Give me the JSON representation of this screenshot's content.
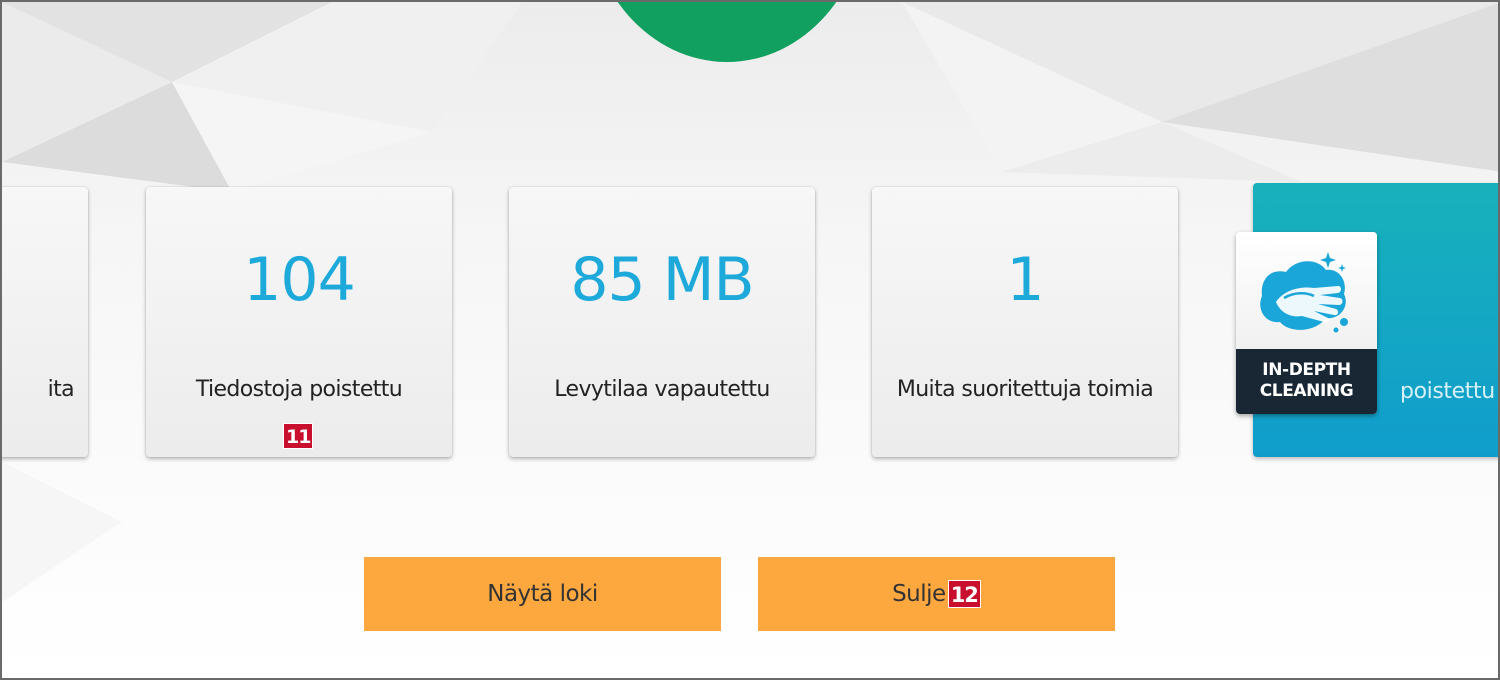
{
  "stats": {
    "partial_label": "ita",
    "files": {
      "value": "104",
      "label": "Tiedostoja poistettu"
    },
    "disk": {
      "value": "85 MB",
      "label": "Levytilaa vapautettu"
    },
    "actions": {
      "value": "1",
      "label": "Muita suoritettuja toimia"
    }
  },
  "promo": {
    "badge_line1": "IN-DEPTH",
    "badge_line2": "CLEANING",
    "side_text": "poistettu",
    "icon": "hand-washing-icon"
  },
  "markers": {
    "m11": "11",
    "m12": "12"
  },
  "buttons": {
    "log": "Näytä loki",
    "close": "Sulje"
  },
  "colors": {
    "accent_value": "#1da9da",
    "button": "#fda83e",
    "header_circle": "#11a05f",
    "promo_bg": "#109dcc",
    "badge_dark": "#192633",
    "marker": "#c8102e"
  }
}
